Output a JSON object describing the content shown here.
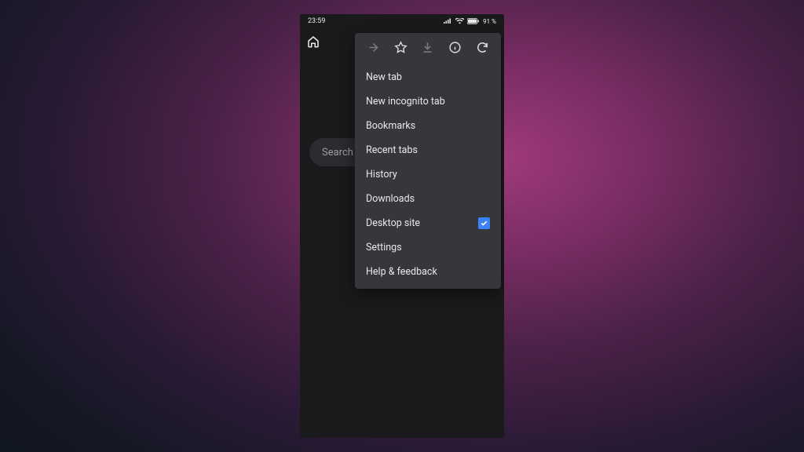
{
  "status": {
    "time": "23:59",
    "battery": "91 %"
  },
  "search": {
    "placeholder": "Search or"
  },
  "menu": {
    "items": {
      "new_tab": "New tab",
      "new_incognito": "New incognito tab",
      "bookmarks": "Bookmarks",
      "recent_tabs": "Recent tabs",
      "history": "History",
      "downloads": "Downloads",
      "desktop_site": "Desktop site",
      "settings": "Settings",
      "help": "Help & feedback"
    },
    "desktop_site_checked": true
  }
}
